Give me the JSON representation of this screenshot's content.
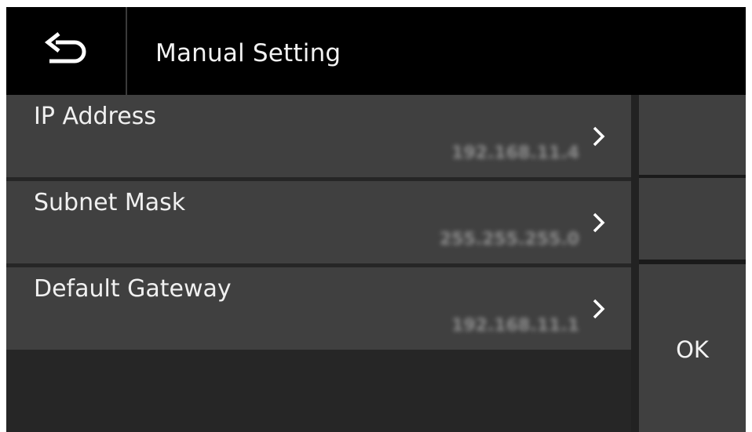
{
  "header": {
    "title": "Manual Setting",
    "back_icon": "return-arrow-icon"
  },
  "rows": [
    {
      "label": "IP Address",
      "value": "192.168.11.4",
      "icon": "chevron-right-icon"
    },
    {
      "label": "Subnet Mask",
      "value": "255.255.255.0",
      "icon": "chevron-right-icon"
    },
    {
      "label": "Default Gateway",
      "value": "192.168.11.1",
      "icon": "chevron-right-icon"
    }
  ],
  "side": {
    "ok_label": "OK"
  },
  "colors": {
    "header_bg": "#000000",
    "row_bg": "#404040",
    "text": "#f0f0f0"
  }
}
